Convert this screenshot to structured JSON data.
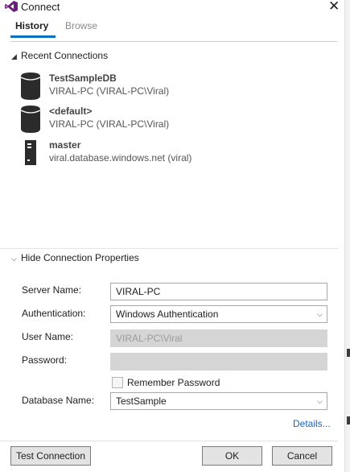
{
  "window": {
    "title": "Connect",
    "icon": "visual-studio-logo-icon",
    "close_icon": "close-icon"
  },
  "tabs": [
    {
      "label": "History",
      "active": true
    },
    {
      "label": "Browse",
      "active": false
    }
  ],
  "recent": {
    "heading": "Recent Connections",
    "expanded": true,
    "items": [
      {
        "name": "TestSampleDB",
        "detail": "VIRAL-PC (VIRAL-PC\\Viral)",
        "icon": "database-icon"
      },
      {
        "name": "<default>",
        "detail": "VIRAL-PC (VIRAL-PC\\Viral)",
        "icon": "database-icon"
      },
      {
        "name": "master",
        "detail": "viral.database.windows.net (viral)",
        "icon": "server-icon"
      }
    ]
  },
  "properties": {
    "heading": "Hide Connection Properties",
    "server_name": {
      "label": "Server Name:",
      "value": "VIRAL-PC"
    },
    "authentication": {
      "label": "Authentication:",
      "value": "Windows Authentication"
    },
    "user_name": {
      "label": "User Name:",
      "value": "VIRAL-PC\\Viral"
    },
    "password": {
      "label": "Password:",
      "value": ""
    },
    "remember_password": {
      "label": "Remember Password",
      "checked": false
    },
    "database_name": {
      "label": "Database Name:",
      "value": "TestSample"
    },
    "details_link": "Details..."
  },
  "buttons": {
    "test_connection": "Test Connection",
    "ok": "OK",
    "cancel": "Cancel"
  },
  "colors": {
    "accent": "#0e70c0",
    "vs_purple": "#68217a",
    "link": "#1a64c4"
  }
}
